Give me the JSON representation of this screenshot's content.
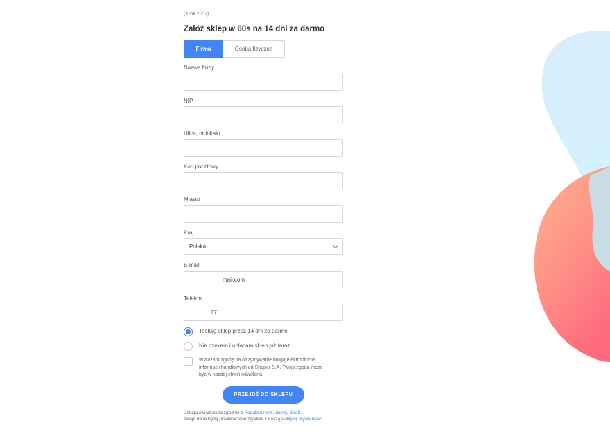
{
  "step_label": "(Krok 2 z 2)",
  "title": "Załóż sklep w 60s na 14 dni za darmo",
  "tabs": [
    {
      "label": "Firma",
      "active": true
    },
    {
      "label": "Osoba fizyczna",
      "active": false
    }
  ],
  "fields": {
    "company_name": {
      "label": "Nazwa firmy",
      "value": ""
    },
    "nip": {
      "label": "NIP",
      "value": ""
    },
    "street": {
      "label": "Ulica, nr lokalu",
      "value": ""
    },
    "postcode": {
      "label": "Kod pocztowy",
      "value": ""
    },
    "city": {
      "label": "Miasto",
      "value": ""
    },
    "country": {
      "label": "Kraj",
      "value": "Polska"
    },
    "email": {
      "label": "E-mail",
      "value": "mail.com"
    },
    "phone": {
      "label": "Telefon",
      "value": "77"
    }
  },
  "plan_options": [
    {
      "label": "Testuję sklep przez 14 dni za darmo",
      "selected": true
    },
    {
      "label": "Nie czekam i opłacam sklep już teraz",
      "selected": false
    }
  ],
  "consent": {
    "line1": "Wyrażam zgodę na otrzymywanie drogą elektroniczną",
    "line2": "informacji handlowych od Shoper S.A. Twoja zgoda może",
    "line3": "być w każdej chwili odwołana.",
    "checked": false
  },
  "submit_label": "PRZEJDŹ DO SKLEPU",
  "footer": {
    "line1_prefix": "Usługa świadczona zgodnie z ",
    "line1_link": "Regulaminem Licencji SaaS.",
    "line2_prefix": "Twoje dane będą przetwarzane zgodnie z naszą ",
    "line2_link": "Polityką prywatności",
    "line2_suffix": "."
  },
  "colors": {
    "accent": "#4285f4",
    "blob_blue": "#d6eefb",
    "blob_orange": "#fbb08c",
    "blob_pink": "#ff6e7f"
  }
}
